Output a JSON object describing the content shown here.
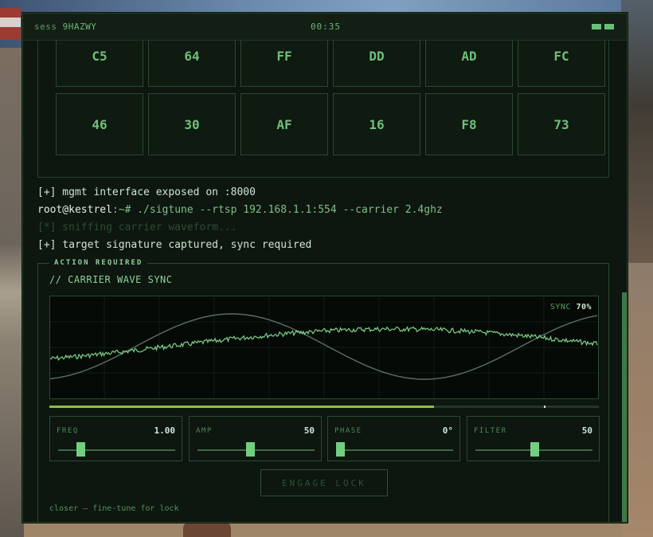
{
  "session": {
    "label": "sess",
    "id": "9HAZWY",
    "timer": "00:35"
  },
  "hex_grid": {
    "rows": [
      [
        "C5",
        "64",
        "FF",
        "DD",
        "AD",
        "FC"
      ],
      [
        "46",
        "30",
        "AF",
        "16",
        "F8",
        "73"
      ]
    ]
  },
  "log": {
    "line1": "[+] mgmt interface exposed on :8000",
    "line2_prompt": "root@kestrel",
    "line2_cmd": ":~# ./sigtune --rtsp 192.168.1.1:554 --carrier 2.4ghz",
    "line3": "[*] sniffing carrier waveform...",
    "line4": "[+] target signature captured, sync required"
  },
  "action": {
    "legend": "ACTION REQUIRED",
    "title": "// CARRIER WAVE SYNC",
    "sync_label": "SYNC",
    "sync_value": "70%",
    "progress_fraction": 0.7,
    "progress_marker_fraction": 0.9,
    "controls": [
      {
        "label": "FREQ",
        "value": "1.00",
        "position": 0.17
      },
      {
        "label": "AMP",
        "value": "50",
        "position": 0.44
      },
      {
        "label": "PHASE",
        "value": "0°",
        "position": 0.0
      },
      {
        "label": "FILTER",
        "value": "50",
        "position": 0.5
      }
    ],
    "engage_label": "ENGAGE LOCK",
    "hint": "closer — fine-tune for lock"
  },
  "colors": {
    "accent": "#72cf80",
    "target_wave": "#7fd08a",
    "player_wave": "#5d6f62",
    "progress": "#8fbf4a"
  }
}
